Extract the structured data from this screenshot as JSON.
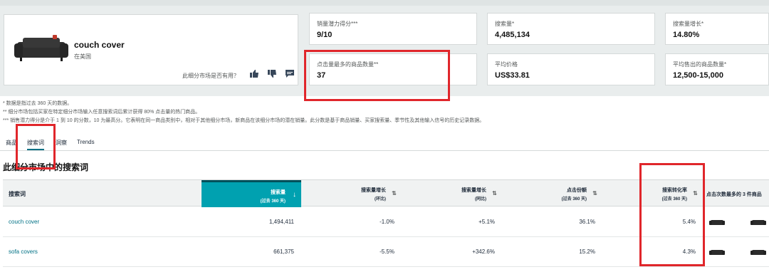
{
  "product": {
    "name": "couch cover",
    "location": "在美国",
    "helpful_prompt": "此细分市场是否有用？"
  },
  "metrics": [
    {
      "label": "销量潜力得分***",
      "value": "9/10"
    },
    {
      "label": "搜索量*",
      "value": "4,485,134"
    },
    {
      "label": "搜索量增长*",
      "value": "14.80%"
    },
    {
      "label": "点击量最多的商品数量**",
      "value": "37"
    },
    {
      "label": "平均价格",
      "value": "US$33.81"
    },
    {
      "label": "平均售出的商品数量*",
      "value": "12,500-15,000"
    }
  ],
  "notes": [
    "* 数据是指过去 360 天的数据。",
    "** 细分市场包括买家在特定细分市场输入任意搜索词后累计获得 80% 点击量的热门商品。",
    "*** 销售潜力得分是介于 1 到 10 的分数，10 为最高分。它表明在同一商品类别中，相对于其他细分市场，新商品在该细分市场的潜在销量。此分数是基于商品销量、买家搜索量、季节性及其他输入信号的历史记录数据。"
  ],
  "tabs": [
    "商品",
    "搜索词",
    "洞察",
    "Trends"
  ],
  "section_title": "此细分市场中的搜索词",
  "table": {
    "headers": {
      "keyword": "搜索词",
      "volume": {
        "main": "搜索量",
        "sub": "(过去 360 天)"
      },
      "growth_qoq": {
        "main": "搜索量增长",
        "sub": "(环比)"
      },
      "growth_yoy": {
        "main": "搜索量增长",
        "sub": "(同比)"
      },
      "click_share": {
        "main": "点击份额",
        "sub": "(过去 360 天)"
      },
      "conversion": {
        "main": "搜索转化率",
        "sub": "(过去 360 天)"
      },
      "top_products": "点击次数最多的 3 件商品"
    },
    "rows": [
      {
        "keyword": "couch cover",
        "volume": "1,494,411",
        "growth_qoq": "-1.0%",
        "growth_yoy": "+5.1%",
        "click_share": "36.1%",
        "conversion": "5.4%"
      },
      {
        "keyword": "sofa covers",
        "volume": "661,375",
        "growth_qoq": "-5.5%",
        "growth_yoy": "+342.6%",
        "click_share": "15.2%",
        "conversion": "4.3%"
      }
    ]
  },
  "colors": {
    "highlight_red": "#e0262b",
    "selected_header": "#00a1b0",
    "link_teal": "#007185"
  }
}
